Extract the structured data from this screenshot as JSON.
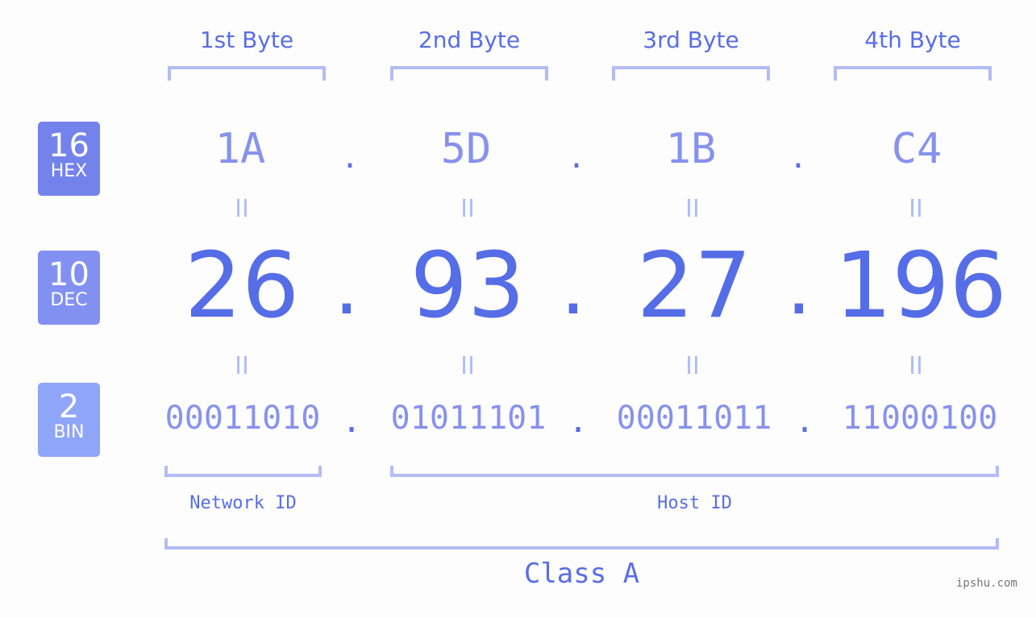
{
  "bytes": [
    {
      "header": "1st Byte",
      "hex": "1A",
      "dec": "26",
      "bin": "00011010"
    },
    {
      "header": "2nd Byte",
      "hex": "5D",
      "dec": "93",
      "bin": "01011101"
    },
    {
      "header": "3rd Byte",
      "hex": "1B",
      "dec": "27",
      "bin": "00011011"
    },
    {
      "header": "4th Byte",
      "hex": "C4",
      "dec": "196",
      "bin": "11000100"
    }
  ],
  "badges": {
    "hex": {
      "base": "16",
      "label": "HEX",
      "color": "#7482ec"
    },
    "dec": {
      "base": "10",
      "label": "DEC",
      "color": "#8291f1"
    },
    "bin": {
      "base": "2",
      "label": "BIN",
      "color": "#8fa5f8"
    }
  },
  "separator": ".",
  "equals": "II",
  "network_id_label": "Network ID",
  "host_id_label": "Host ID",
  "class_label": "Class A",
  "watermark": "ipshu.com"
}
